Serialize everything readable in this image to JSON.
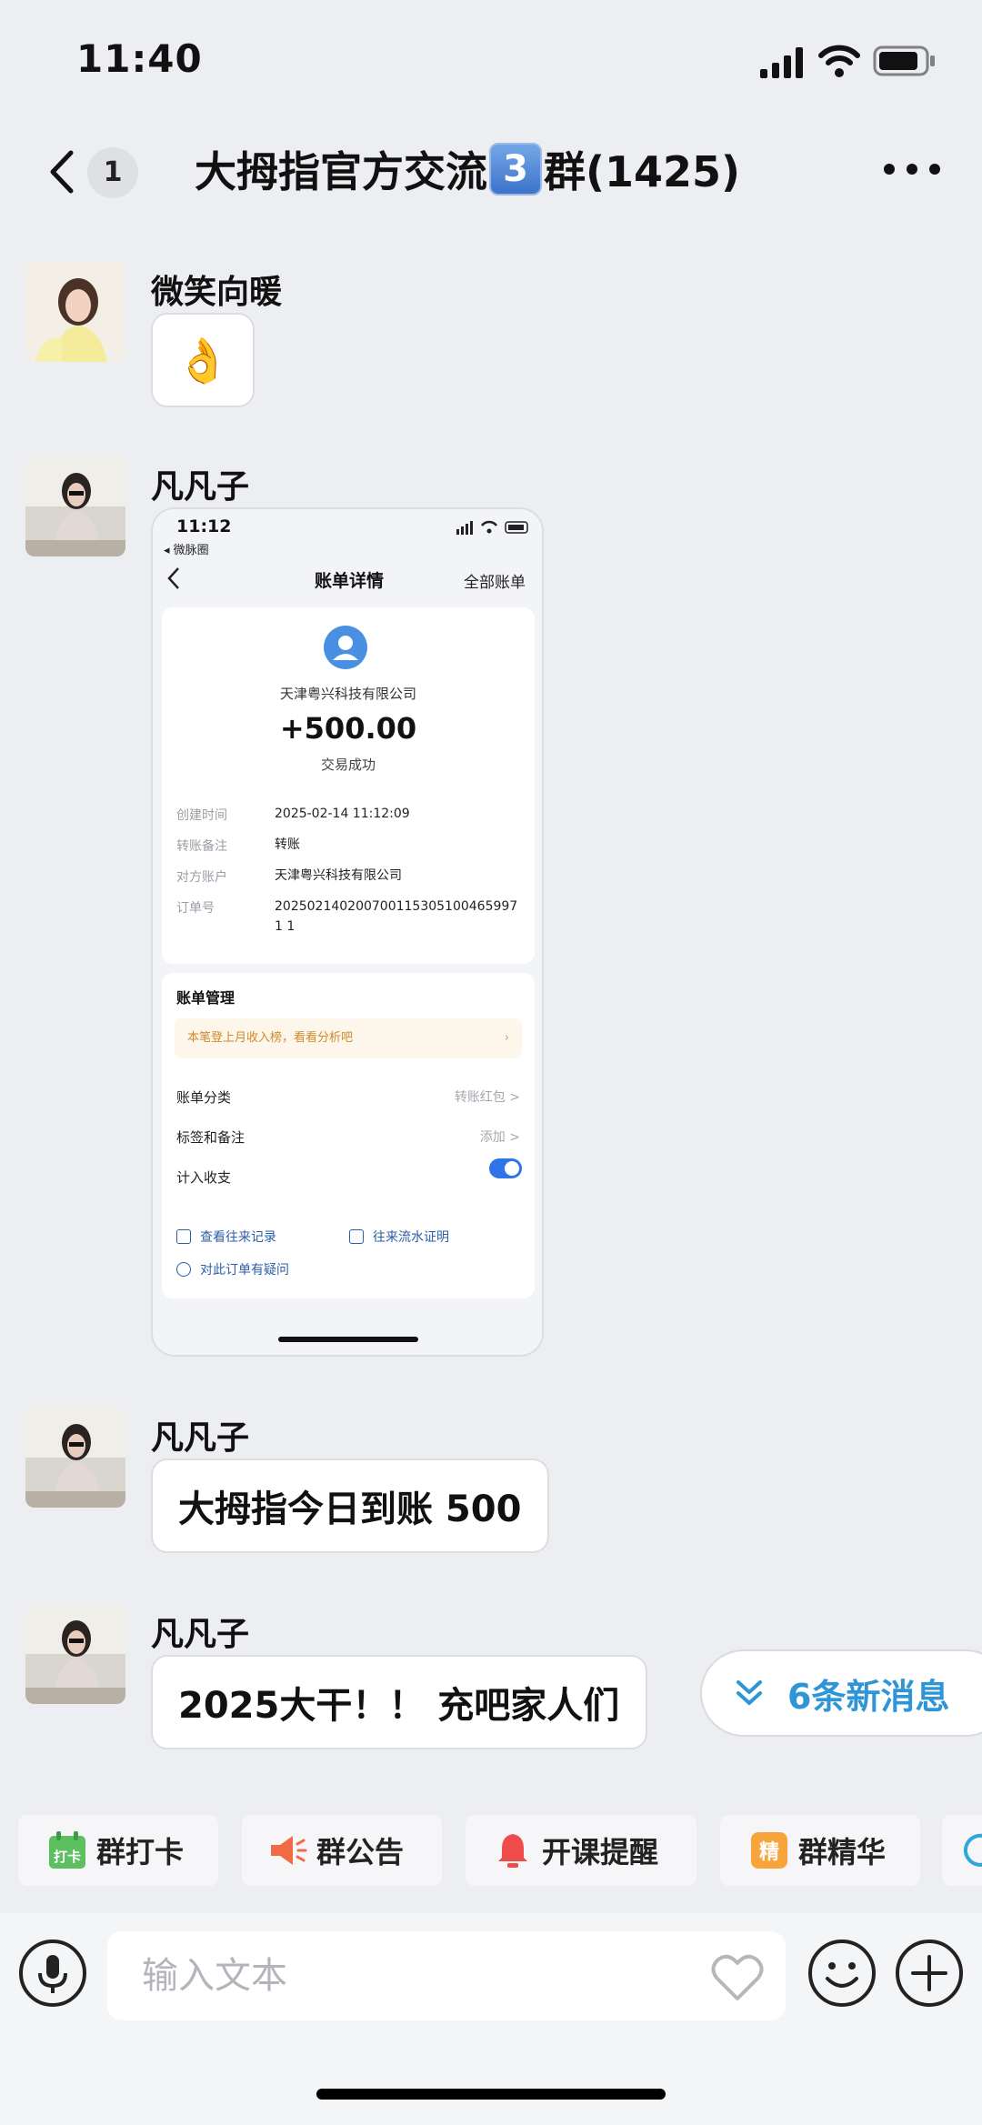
{
  "status_bar": {
    "time": "11:40"
  },
  "nav": {
    "unread_count": "1",
    "title_prefix": "大拇指官方交流",
    "title_number": "3",
    "title_suffix": "群(1425)"
  },
  "messages": [
    {
      "sender": "微笑向暖",
      "content": "👌"
    },
    {
      "sender": "凡凡子",
      "content": ""
    },
    {
      "sender": "凡凡子",
      "content": "大拇指今日到账 500"
    },
    {
      "sender": "凡凡子",
      "content": "2025大干！！ 充吧家人们"
    }
  ],
  "receipt": {
    "time": "11:12",
    "back_label": "◂ 微脉圈",
    "title": "账单详情",
    "all_bills": "全部账单",
    "company": "天津粤兴科技有限公司",
    "amount": "+500.00",
    "result": "交易成功",
    "rows": [
      {
        "label": "创建时间",
        "value": "2025-02-14 11:12:09"
      },
      {
        "label": "转账备注",
        "value": "转账"
      },
      {
        "label": "对方账户",
        "value": "天津粤兴科技有限公司"
      },
      {
        "label": "订单号",
        "value": "2025021402007001153051004659971 1"
      }
    ],
    "management_title": "账单管理",
    "tip": "本笔登上月收入榜，看看分析吧",
    "items": [
      {
        "label": "账单分类",
        "value": "转账红包 >"
      },
      {
        "label": "标签和备注",
        "value": "添加 >"
      },
      {
        "label": "计入收支",
        "value": ""
      }
    ],
    "toggle_on": true,
    "links": [
      "查看往来记录",
      "往来流水证明",
      "对此订单有疑问"
    ]
  },
  "new_messages": "6条新消息",
  "quick_actions": [
    {
      "label": "群打卡",
      "icon": "checkin-icon",
      "icon_text": "打卡",
      "color": "#5cc060"
    },
    {
      "label": "群公告",
      "icon": "megaphone-icon",
      "color": "#f06a45"
    },
    {
      "label": "开课提醒",
      "icon": "bell-icon",
      "color": "#f04b4b"
    },
    {
      "label": "群精华",
      "icon": "essence-icon",
      "icon_text": "精",
      "color": "#f7a53a"
    }
  ],
  "input": {
    "placeholder": "输入文本",
    "value": ""
  },
  "colors": {
    "accent": "#2f95d6",
    "toggle": "#2f74e8",
    "background": "#edeef2"
  }
}
